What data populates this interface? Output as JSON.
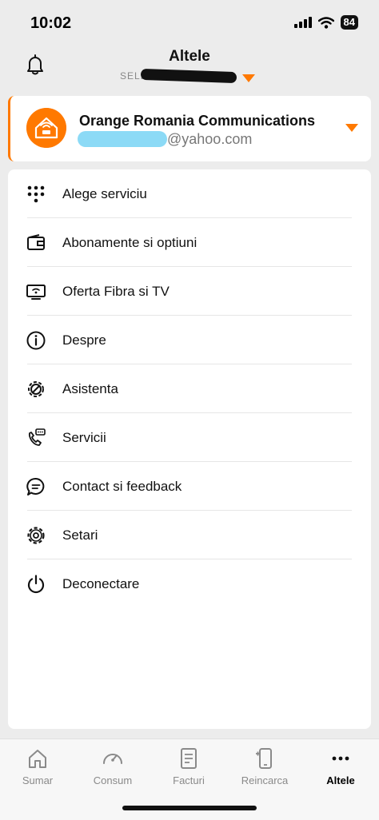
{
  "status_bar": {
    "time": "10:02",
    "battery": "84"
  },
  "header": {
    "title": "Altele",
    "subtitle": "SELE"
  },
  "account": {
    "name": "Orange Romania Communications",
    "email_domain": "@yahoo.com"
  },
  "menu": {
    "items": [
      {
        "label": "Alege serviciu",
        "icon": "dial-pad-icon"
      },
      {
        "label": "Abonamente si optiuni",
        "icon": "wallet-icon"
      },
      {
        "label": "Oferta Fibra si TV",
        "icon": "tv-wifi-icon"
      },
      {
        "label": "Despre",
        "icon": "info-icon"
      },
      {
        "label": "Asistenta",
        "icon": "gear-wrench-icon"
      },
      {
        "label": "Servicii",
        "icon": "phone-chat-icon"
      },
      {
        "label": "Contact si feedback",
        "icon": "chat-bubble-icon"
      },
      {
        "label": "Setari",
        "icon": "gear-icon"
      },
      {
        "label": "Deconectare",
        "icon": "power-icon"
      }
    ]
  },
  "tabs": [
    {
      "label": "Sumar",
      "icon": "home-icon"
    },
    {
      "label": "Consum",
      "icon": "gauge-icon"
    },
    {
      "label": "Facturi",
      "icon": "invoice-icon"
    },
    {
      "label": "Reincarca",
      "icon": "phone-topup-icon"
    },
    {
      "label": "Altele",
      "icon": "more-dots-icon",
      "active": true
    }
  ],
  "colors": {
    "accent": "#ff7900",
    "background": "#ececec",
    "card": "#ffffff"
  }
}
